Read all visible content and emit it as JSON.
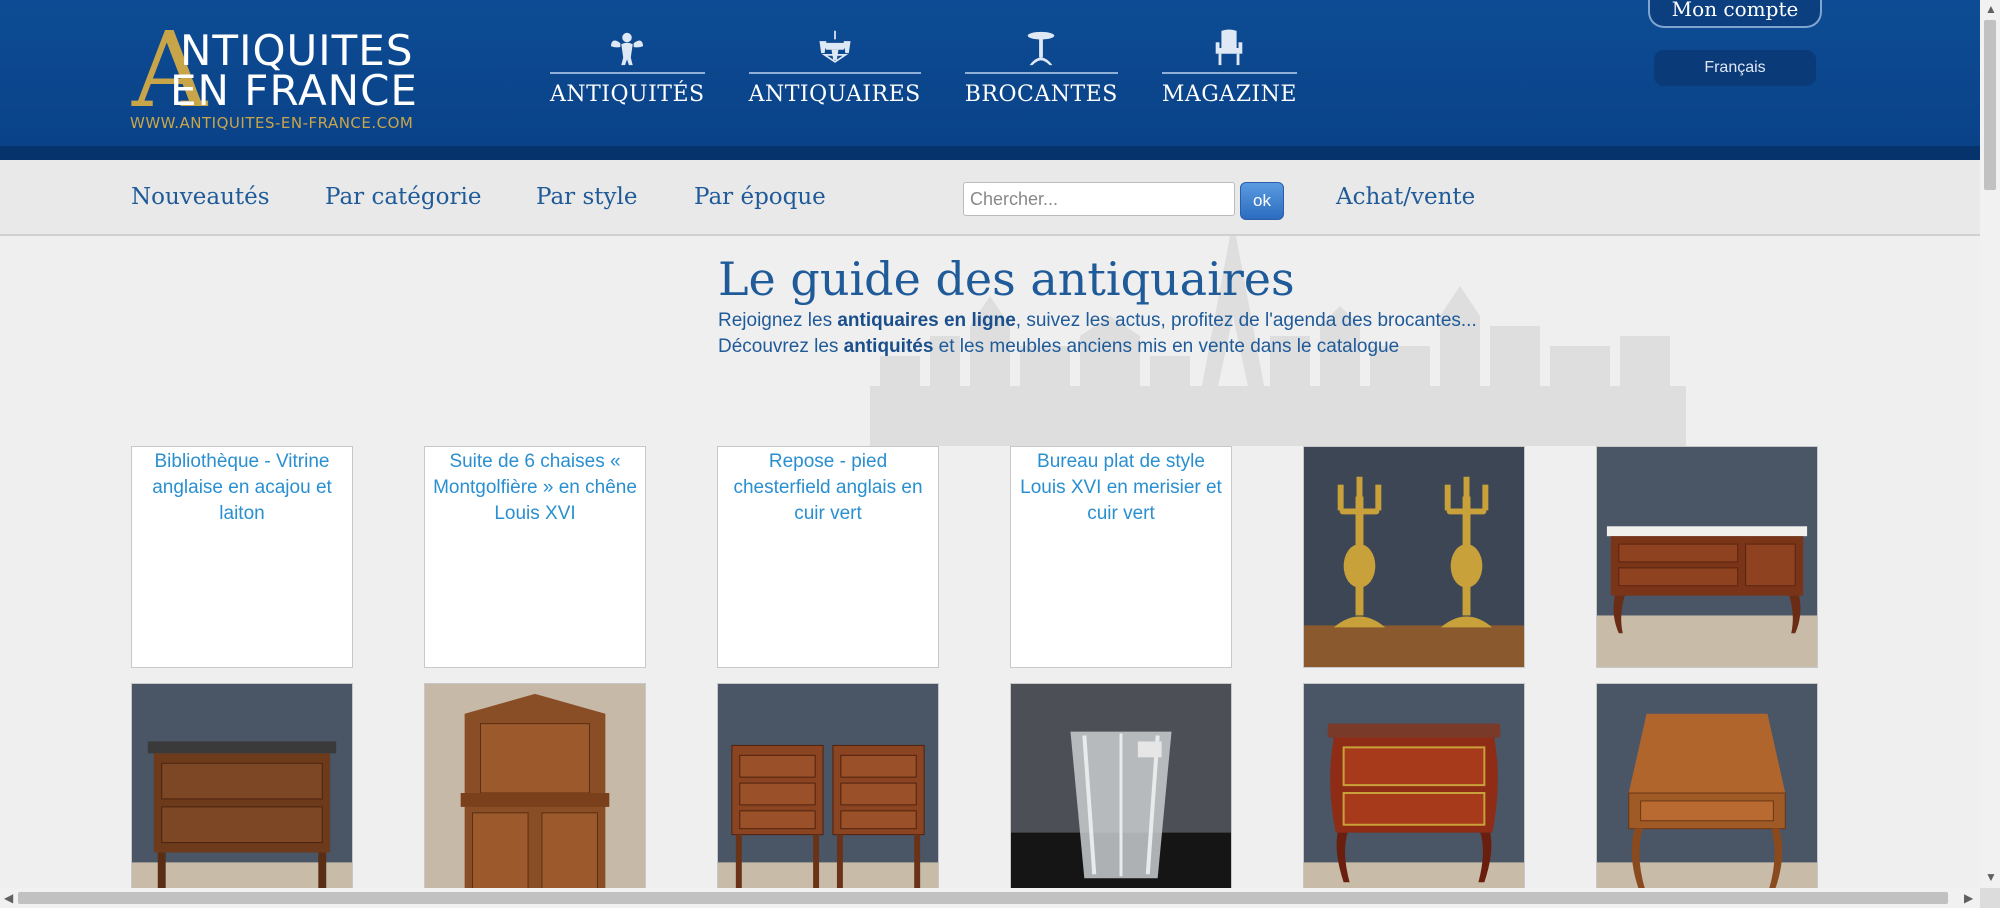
{
  "header": {
    "logo": {
      "line1": "NTIQUITES",
      "line2": "EN FRANCE",
      "url": "WWW.ANTIQUITES-EN-FRANCE.COM",
      "big_letter": "A"
    },
    "nav": [
      {
        "label": "ANTIQUITÉS",
        "icon": "cherub-icon"
      },
      {
        "label": "ANTIQUAIRES",
        "icon": "chandelier-icon"
      },
      {
        "label": "BROCANTES",
        "icon": "pedestal-table-icon"
      },
      {
        "label": "MAGAZINE",
        "icon": "armchair-icon"
      }
    ],
    "account_label": "Mon compte",
    "language": "Français"
  },
  "subnav": {
    "items": [
      "Nouveautés",
      "Par catégorie",
      "Par style",
      "Par époque"
    ],
    "search_placeholder": "Chercher...",
    "ok_label": "ok",
    "achat_label": "Achat/vente"
  },
  "hero": {
    "title": "Le guide des antiquaires",
    "line1_pre": "Rejoignez les ",
    "line1_bold": "antiquaires en ligne",
    "line1_post": ", suivez les actus, profitez de l'agenda des brocantes...",
    "line2_pre": "Découvrez les ",
    "line2_bold": "antiquités",
    "line2_post": " et les meubles anciens mis en vente dans le catalogue"
  },
  "tiles": [
    {
      "alt": "Bibliothèque - Vitrine anglaise en acajou et laiton",
      "type": "broken"
    },
    {
      "alt": "Suite de 6 chaises « Montgolfière » en chêne Louis XVI",
      "type": "broken"
    },
    {
      "alt": "Repose - pied chesterfield anglais en cuir vert",
      "type": "broken"
    },
    {
      "alt": "Bureau plat de style Louis XVI en merisier et cuir vert",
      "type": "broken"
    },
    {
      "type": "candelabras"
    },
    {
      "type": "marble-commode"
    },
    {
      "type": "commode"
    },
    {
      "type": "buffet"
    },
    {
      "type": "nightstands"
    },
    {
      "type": "vase"
    },
    {
      "type": "marquetry-commode"
    },
    {
      "type": "secretary-desk"
    }
  ],
  "colors": {
    "header_blue": "#0d4c94",
    "gold": "#c9a54a",
    "link_blue": "#1f5a99",
    "alt_text_blue": "#2a8fd0"
  }
}
